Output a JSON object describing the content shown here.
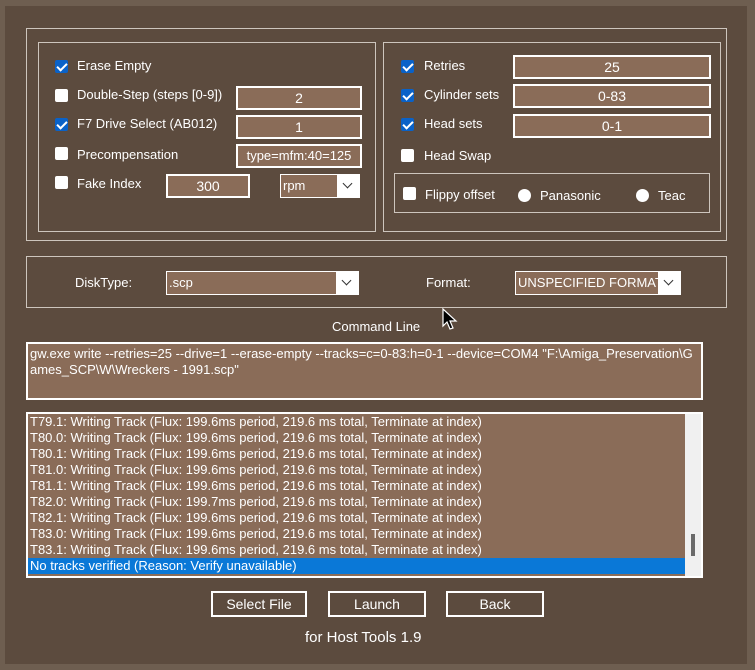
{
  "options": {
    "erase_empty": {
      "label": "Erase Empty",
      "checked": true
    },
    "double_step": {
      "label": "Double-Step (steps [0-9])",
      "checked": false,
      "value": "2"
    },
    "f7_drive_select": {
      "label": "F7 Drive Select (AB012)",
      "checked": true,
      "value": "1"
    },
    "precompensation": {
      "label": "Precompensation",
      "checked": false,
      "value": "type=mfm:40=125"
    },
    "fake_index": {
      "label": "Fake Index",
      "checked": false,
      "value": "300",
      "unit": "rpm"
    }
  },
  "retry_options": {
    "retries": {
      "label": "Retries",
      "checked": true,
      "value": "25"
    },
    "cylinder_sets": {
      "label": "Cylinder sets",
      "checked": true,
      "value": "0-83"
    },
    "head_sets": {
      "label": "Head sets",
      "checked": true,
      "value": "0-1"
    },
    "head_swap": {
      "label": "Head Swap",
      "checked": false
    },
    "flippy_offset": {
      "label": "Flippy offset",
      "checked": false
    },
    "panasonic": {
      "label": "Panasonic"
    },
    "teac": {
      "label": "Teac"
    }
  },
  "disk": {
    "disktype_label": "DiskType:",
    "disktype_value": ".scp",
    "format_label": "Format:",
    "format_value": "UNSPECIFIED FORMAT"
  },
  "command": {
    "label": "Command Line",
    "text": "gw.exe write --retries=25 --drive=1 --erase-empty --tracks=c=0-83:h=0-1 --device=COM4 \"F:\\Amiga_Preservation\\Games_SCP\\W\\Wreckers - 1991.scp\""
  },
  "log": [
    "T79.1: Writing Track (Flux: 199.6ms period, 219.6 ms total, Terminate at index)",
    "T80.0: Writing Track (Flux: 199.6ms period, 219.6 ms total, Terminate at index)",
    "T80.1: Writing Track (Flux: 199.6ms period, 219.6 ms total, Terminate at index)",
    "T81.0: Writing Track (Flux: 199.6ms period, 219.6 ms total, Terminate at index)",
    "T81.1: Writing Track (Flux: 199.6ms period, 219.6 ms total, Terminate at index)",
    "T82.0: Writing Track (Flux: 199.7ms period, 219.6 ms total, Terminate at index)",
    "T82.1: Writing Track (Flux: 199.6ms period, 219.6 ms total, Terminate at index)",
    "T83.0: Writing Track (Flux: 199.6ms period, 219.6 ms total, Terminate at index)",
    "T83.1: Writing Track (Flux: 199.6ms period, 219.6 ms total, Terminate at index)",
    "No tracks verified (Reason: Verify unavailable)"
  ],
  "buttons": {
    "select_file": "Select File",
    "launch": "Launch",
    "back": "Back"
  },
  "footer": "for Host Tools 1.9",
  "colors": {
    "background": "#5c4b3e",
    "field": "#8a6c58",
    "selection": "#0a78d7",
    "checkbox": "#0a62c8"
  }
}
